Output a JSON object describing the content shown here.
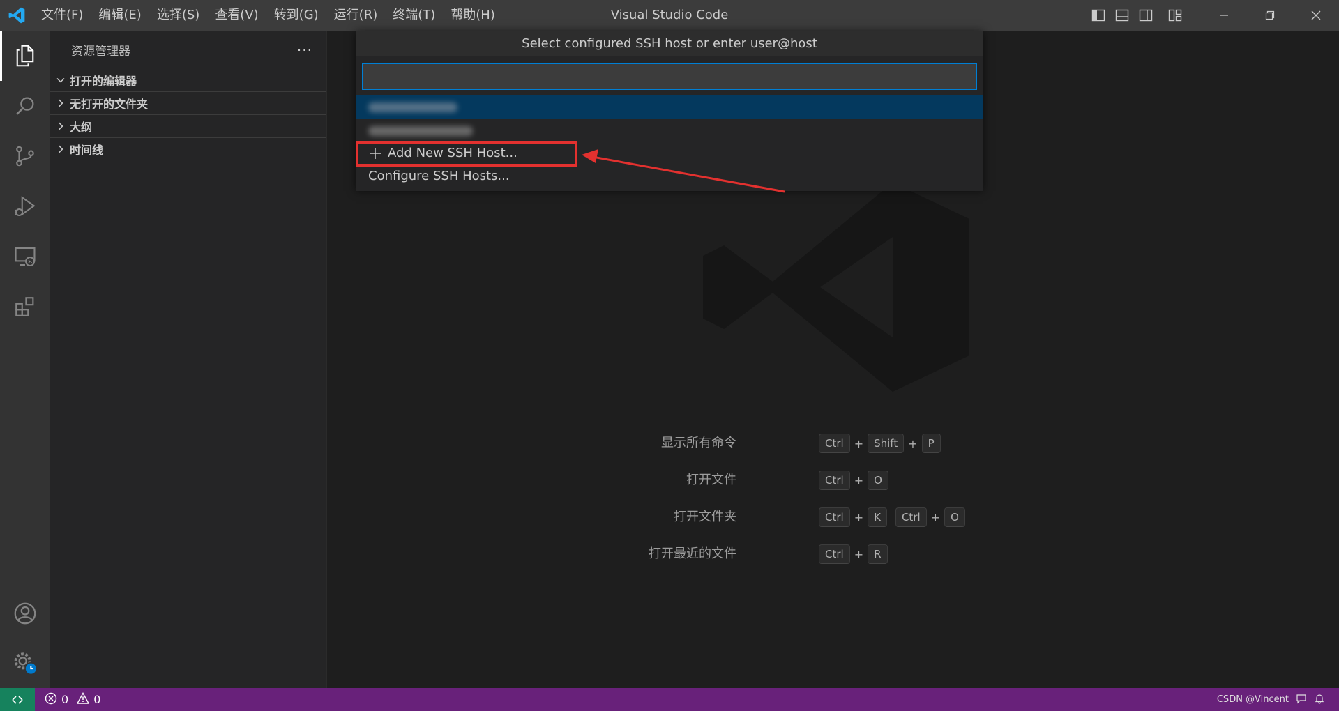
{
  "window": {
    "title": "Visual Studio Code"
  },
  "menu": [
    "文件(F)",
    "编辑(E)",
    "选择(S)",
    "查看(V)",
    "转到(G)",
    "运行(R)",
    "终端(T)",
    "帮助(H)"
  ],
  "sidebar": {
    "title": "资源管理器",
    "more": "···",
    "sections": [
      {
        "label": "打开的编辑器",
        "expanded": true
      },
      {
        "label": "无打开的文件夹",
        "expanded": false
      },
      {
        "label": "大纲",
        "expanded": false
      },
      {
        "label": "时间线",
        "expanded": false
      }
    ]
  },
  "quickpick": {
    "title": "Select configured SSH host or enter user@host",
    "input_value": "",
    "add_label": "Add New SSH Host...",
    "config_label": "Configure SSH Hosts..."
  },
  "shortcuts": [
    {
      "label": "显示所有命令",
      "keys": [
        [
          "Ctrl",
          "Shift",
          "P"
        ]
      ]
    },
    {
      "label": "打开文件",
      "keys": [
        [
          "Ctrl",
          "O"
        ]
      ]
    },
    {
      "label": "打开文件夹",
      "keys": [
        [
          "Ctrl",
          "K"
        ],
        [
          "Ctrl",
          "O"
        ]
      ]
    },
    {
      "label": "打开最近的文件",
      "keys": [
        [
          "Ctrl",
          "R"
        ]
      ]
    }
  ],
  "status": {
    "errors": "0",
    "warnings": "0",
    "watermark": "CSDN @Vincent"
  },
  "colors": {
    "statusbar": "#68217a",
    "remote": "#16825d",
    "accent": "#007fd4",
    "selection": "#04395e",
    "highlight": "#e3312f"
  }
}
